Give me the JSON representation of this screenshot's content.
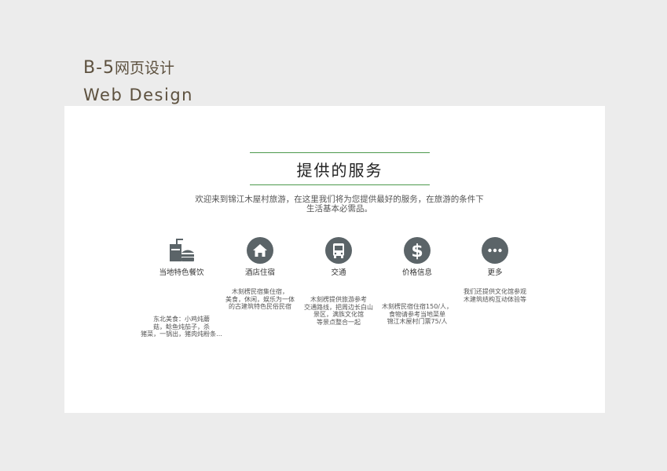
{
  "slide": {
    "title_prefix": "B-5",
    "title_cn": "网页设计",
    "subtitle": "Web Design"
  },
  "section": {
    "heading": "提供的服务",
    "intro_line1": "欢迎来到锦江木屋村旅游，在这里我们将为您提供最好的服务，在旅游的条件下",
    "intro_line2": "生活基本必需品。"
  },
  "services": [
    {
      "label": "当地特色餐饮",
      "icon": "food-drink-icon",
      "desc": [
        "东北美食：小鸡炖蘑",
        "菇，鲶鱼炖茄子，杀",
        "猪菜，一锅出，猪肉炖粉条..."
      ]
    },
    {
      "label": "酒店住宿",
      "icon": "house-icon",
      "desc": [
        "木刻楞民宿集住宿，",
        "美食，休闲，娱乐为一体",
        "的古建筑特色民俗民宿"
      ]
    },
    {
      "label": "交通",
      "icon": "bus-icon",
      "desc": [
        "木刻楞提供旅游参考",
        "交通路线，把周边长白山",
        "景区，满族文化馆",
        "等景点整合一起"
      ]
    },
    {
      "label": "价格信息",
      "icon": "dollar-icon",
      "desc": [
        "木刻楞民宿住宿150/人，",
        "食物请参考当地菜单",
        "锦江木屋村门票75/人"
      ]
    },
    {
      "label": "更多",
      "icon": "more-icon",
      "desc": [
        "我们还提供文化馆参观",
        "木建筑结构互动体验等"
      ]
    }
  ],
  "colors": {
    "icon_fill": "#5b6468",
    "accent_line": "#4d9a4d",
    "title_brown": "#5d513f"
  }
}
